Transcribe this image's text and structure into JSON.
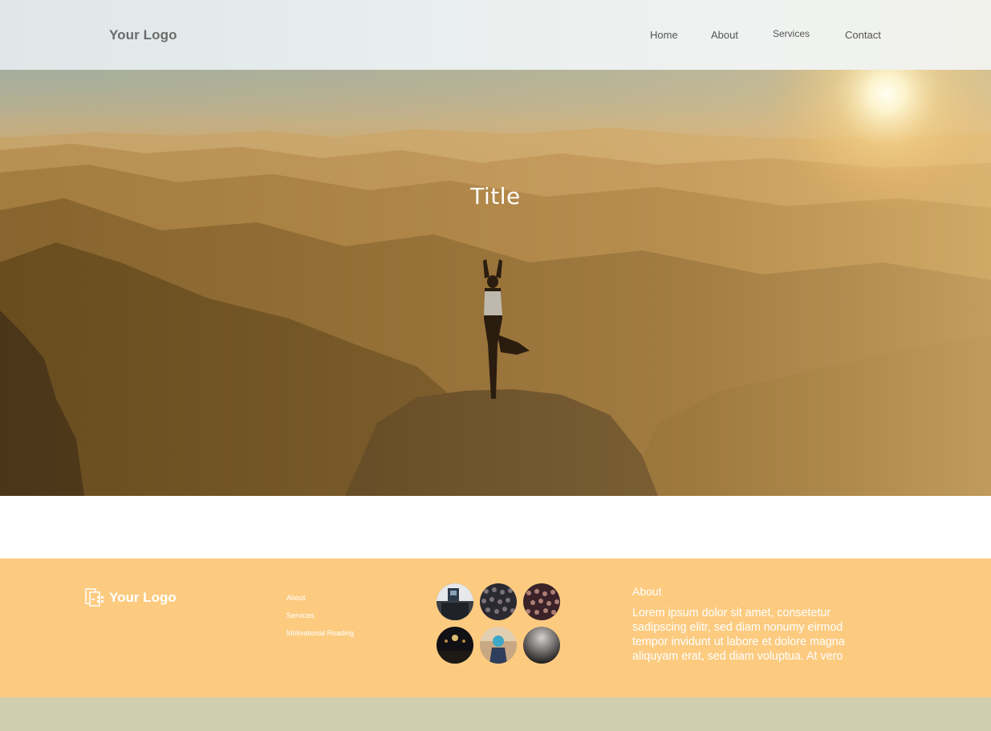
{
  "header": {
    "logo": "Your Logo",
    "nav": [
      "Home",
      "About",
      "Services",
      "Contact"
    ]
  },
  "hero": {
    "title": "Title",
    "image": "woman-yoga-on-mountain-peak-at-sunset"
  },
  "footer": {
    "logo": "Your Logo",
    "logo_icon": "document-logo-icon",
    "links": [
      "About",
      "Services",
      "Motivational Reading"
    ],
    "gallery": [
      "exhibition-photo",
      "crowd-photo",
      "audience-photo",
      "concert-lights-photo",
      "speaker-photo",
      "dark-stage-photo"
    ],
    "about_heading": "About",
    "about_text": "Lorem ipsum dolor sit amet, consetetur sadipscing elitr, sed diam nonumy eirmod tempor invidunt ut labore et dolore magna aliquyam erat, sed diam voluptua. At vero"
  },
  "colors": {
    "footer_bg": "#fccb80",
    "bottom_bar": "#cfcfae",
    "nav_text": "#555555",
    "logo_text": "#6b6b6b"
  }
}
